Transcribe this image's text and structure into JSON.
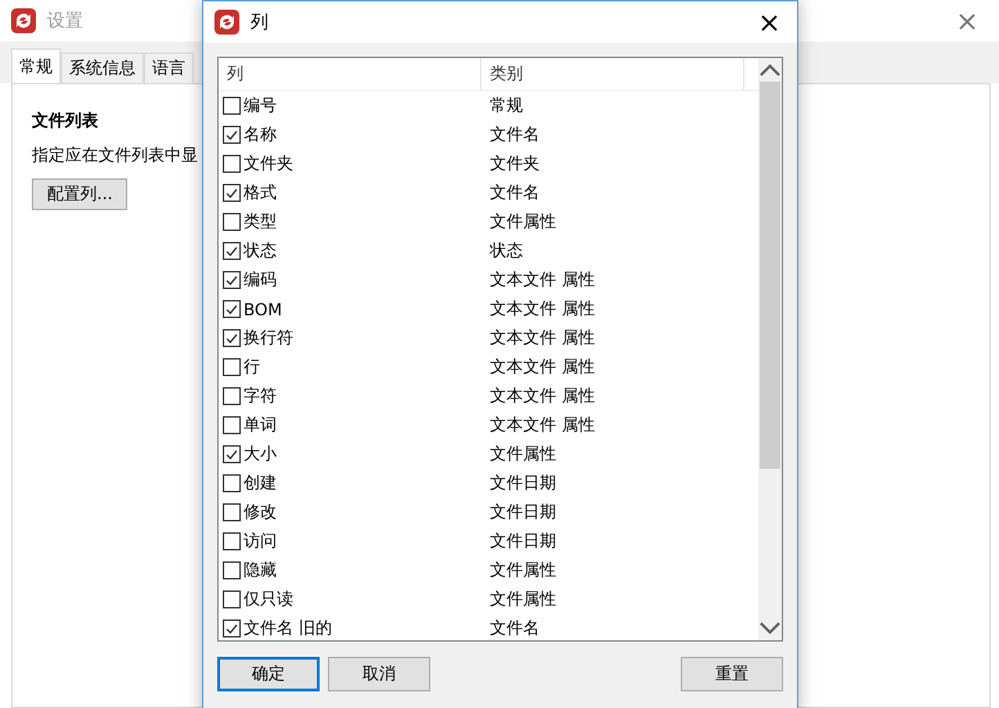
{
  "window": {
    "title": "设置",
    "close": "×"
  },
  "tabs": [
    {
      "label": "常规",
      "selected": true
    },
    {
      "label": "系统信息",
      "selected": false
    },
    {
      "label": "语言",
      "selected": false
    }
  ],
  "section": {
    "heading": "文件列表",
    "description": "指定应在文件列表中显",
    "button": "配置列..."
  },
  "dialog": {
    "title": "列",
    "close": "×",
    "columns": [
      "列",
      "类别"
    ],
    "rows": [
      {
        "name": "编号",
        "category": "常规",
        "checked": false
      },
      {
        "name": "名称",
        "category": "文件名",
        "checked": true
      },
      {
        "name": "文件夹",
        "category": "文件夹",
        "checked": false
      },
      {
        "name": "格式",
        "category": "文件名",
        "checked": true
      },
      {
        "name": "类型",
        "category": "文件属性",
        "checked": false
      },
      {
        "name": "状态",
        "category": "状态",
        "checked": true
      },
      {
        "name": "编码",
        "category": "文本文件 属性",
        "checked": true
      },
      {
        "name": "BOM",
        "category": "文本文件 属性",
        "checked": true
      },
      {
        "name": "换行符",
        "category": "文本文件 属性",
        "checked": true
      },
      {
        "name": "行",
        "category": "文本文件 属性",
        "checked": false
      },
      {
        "name": "字符",
        "category": "文本文件 属性",
        "checked": false
      },
      {
        "name": "单词",
        "category": "文本文件 属性",
        "checked": false
      },
      {
        "name": "大小",
        "category": "文件属性",
        "checked": true
      },
      {
        "name": "创建",
        "category": "文件日期",
        "checked": false
      },
      {
        "name": "修改",
        "category": "文件日期",
        "checked": false
      },
      {
        "name": "访问",
        "category": "文件日期",
        "checked": false
      },
      {
        "name": "隐藏",
        "category": "文件属性",
        "checked": false
      },
      {
        "name": "仅只读",
        "category": "文件属性",
        "checked": false
      },
      {
        "name": "文件名 旧的",
        "category": "文件名",
        "checked": true
      }
    ],
    "buttons": [
      {
        "label": "确定",
        "kind": "default"
      },
      {
        "label": "取消",
        "kind": "normal"
      },
      {
        "label": "重置",
        "kind": "reset"
      }
    ]
  }
}
